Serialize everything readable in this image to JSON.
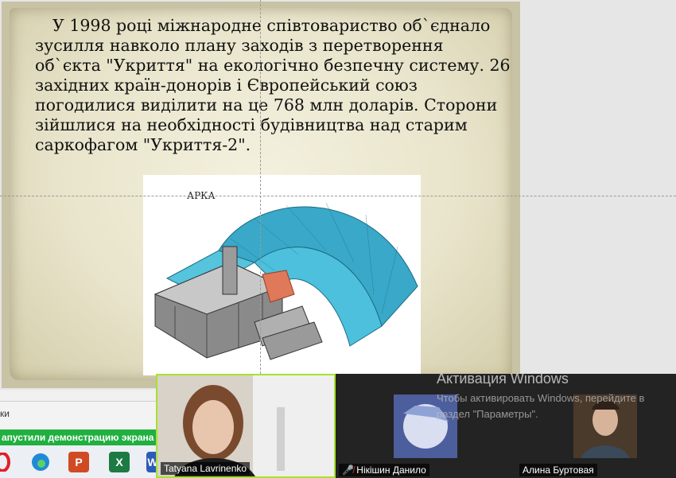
{
  "slide": {
    "text": "У 1998 році міжнародне співтовариство об`єднало зусилля навколо плану заходів з перетворення об`єкта \"Укриття\" на екологічно безпечну систему. 26 західних країн-донорів і Європейський союз погодилися виділити на це 768 млн доларів. Сторони зійшлися на необхідності будівництва над старим саркофагом \"Укриття-2\".",
    "image_label": "АРКА"
  },
  "app": {
    "notes_label": "ки",
    "share_banner": "апустили демонстрацию экрана"
  },
  "taskbar": {
    "icons": [
      "opera-icon",
      "edge-icon",
      "powerpoint-icon",
      "excel-icon",
      "word-icon"
    ]
  },
  "participants": [
    {
      "name": "Tatyana Lavrinenko",
      "muted": false
    },
    {
      "name": "Нікішин Данило",
      "muted": true
    },
    {
      "name": "Алина Буртовая",
      "muted": false
    }
  ],
  "windows_watermark": {
    "title": "Активация Windows",
    "subtitle": "Чтобы активировать Windows, перейдите в раздел \"Параметры\"."
  },
  "colors": {
    "share_banner": "#20b040",
    "active_speaker": "#a6e22e",
    "mic_muted": "#e03030"
  }
}
